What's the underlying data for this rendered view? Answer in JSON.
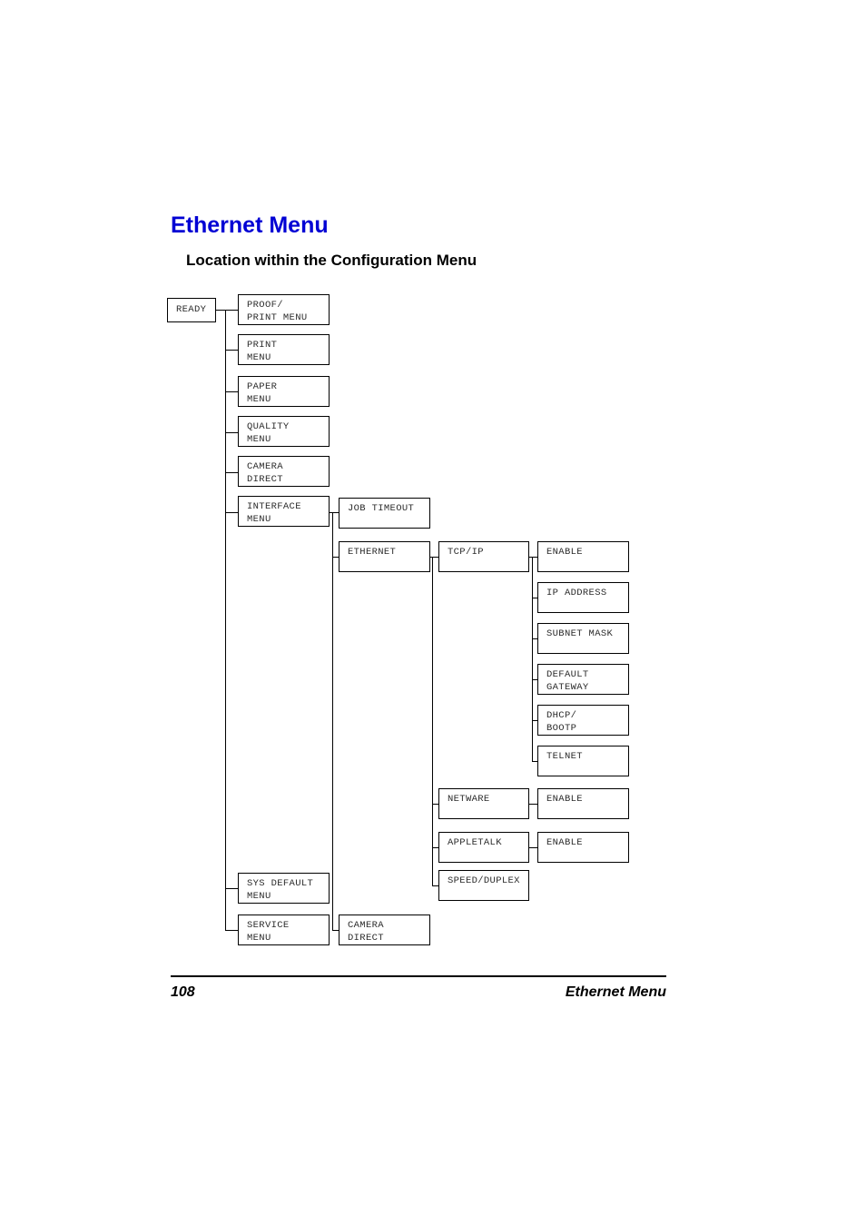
{
  "page": {
    "title": "Ethernet Menu",
    "subtitle": "Location within the Configuration Menu",
    "title_color": "#0000d4"
  },
  "footer": {
    "page_number": "108",
    "section_label": "Ethernet Menu"
  },
  "diagram": {
    "root": {
      "label": "READY"
    },
    "column1": [
      {
        "label": "PROOF/\nPRINT MENU"
      },
      {
        "label": "PRINT\nMENU"
      },
      {
        "label": "PAPER\nMENU"
      },
      {
        "label": "QUALITY\nMENU"
      },
      {
        "label": "CAMERA\nDIRECT"
      },
      {
        "label": "INTERFACE\nMENU"
      },
      {
        "label": "SYS DEFAULT\nMENU"
      },
      {
        "label": "SERVICE\nMENU"
      }
    ],
    "column2": [
      {
        "label": "JOB TIMEOUT"
      },
      {
        "label": "ETHERNET"
      },
      {
        "label": "CAMERA\nDIRECT"
      }
    ],
    "column3": [
      {
        "label": "TCP/IP"
      },
      {
        "label": "NETWARE"
      },
      {
        "label": "APPLETALK"
      },
      {
        "label": "SPEED/DUPLEX"
      }
    ],
    "column4_tcpip": [
      {
        "label": "ENABLE"
      },
      {
        "label": "IP ADDRESS"
      },
      {
        "label": "SUBNET MASK"
      },
      {
        "label": "DEFAULT\nGATEWAY"
      },
      {
        "label": "DHCP/\nBOOTP"
      },
      {
        "label": "TELNET"
      }
    ],
    "column4_netware": [
      {
        "label": "ENABLE"
      }
    ],
    "column4_appletalk": [
      {
        "label": "ENABLE"
      }
    ]
  }
}
